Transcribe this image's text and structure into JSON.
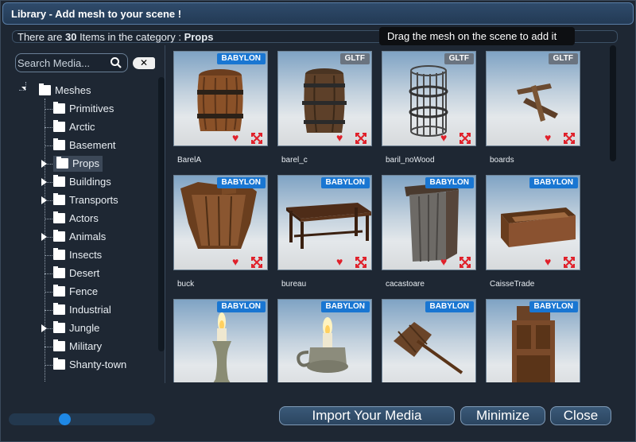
{
  "window": {
    "title": "Library - Add mesh to your scene !"
  },
  "info": {
    "prefix": "There are ",
    "count": "30",
    "middle": " Items in the category : ",
    "category": "Props"
  },
  "tooltip": "Drag the mesh on the scene to add it",
  "search": {
    "placeholder": "Search Media..."
  },
  "tree": {
    "root": "Meshes",
    "items": [
      {
        "label": "Primitives",
        "expandable": false,
        "selected": false
      },
      {
        "label": "Arctic",
        "expandable": false,
        "selected": false
      },
      {
        "label": "Basement",
        "expandable": false,
        "selected": false
      },
      {
        "label": "Props",
        "expandable": true,
        "selected": true
      },
      {
        "label": "Buildings",
        "expandable": true,
        "selected": false
      },
      {
        "label": "Transports",
        "expandable": true,
        "selected": false
      },
      {
        "label": "Actors",
        "expandable": false,
        "selected": false
      },
      {
        "label": "Animals",
        "expandable": true,
        "selected": false
      },
      {
        "label": "Insects",
        "expandable": false,
        "selected": false
      },
      {
        "label": "Desert",
        "expandable": false,
        "selected": false
      },
      {
        "label": "Fence",
        "expandable": false,
        "selected": false
      },
      {
        "label": "Industrial",
        "expandable": false,
        "selected": false
      },
      {
        "label": "Jungle",
        "expandable": true,
        "selected": false
      },
      {
        "label": "Military",
        "expandable": false,
        "selected": false
      },
      {
        "label": "Shanty-town",
        "expandable": false,
        "selected": false
      }
    ]
  },
  "media": [
    {
      "name": "BarelA",
      "badge": "BABYLON",
      "icon": "barrel"
    },
    {
      "name": "barel_c",
      "badge": "GLTF",
      "icon": "barrel-dark"
    },
    {
      "name": "baril_noWood",
      "badge": "GLTF",
      "icon": "cage"
    },
    {
      "name": "boards",
      "badge": "GLTF",
      "icon": "boards"
    },
    {
      "name": "buck",
      "badge": "BABYLON",
      "icon": "bucket"
    },
    {
      "name": "bureau",
      "badge": "BABYLON",
      "icon": "table"
    },
    {
      "name": "cacastoare",
      "badge": "BABYLON",
      "icon": "outhouse"
    },
    {
      "name": "CaisseTrade",
      "badge": "BABYLON",
      "icon": "crate"
    },
    {
      "name": "",
      "badge": "BABYLON",
      "icon": "candle"
    },
    {
      "name": "",
      "badge": "BABYLON",
      "icon": "candle-holder"
    },
    {
      "name": "",
      "badge": "BABYLON",
      "icon": "axe"
    },
    {
      "name": "",
      "badge": "BABYLON",
      "icon": "cabinet"
    }
  ],
  "slider": {
    "value": 0.37
  },
  "buttons": {
    "import": "Import Your Media",
    "minimize": "Minimize",
    "close": "Close"
  },
  "colors": {
    "accent": "#1e88e5",
    "babylon_badge": "#1976d2",
    "gltf_badge": "#6a7480",
    "heart": "#e0202a"
  }
}
